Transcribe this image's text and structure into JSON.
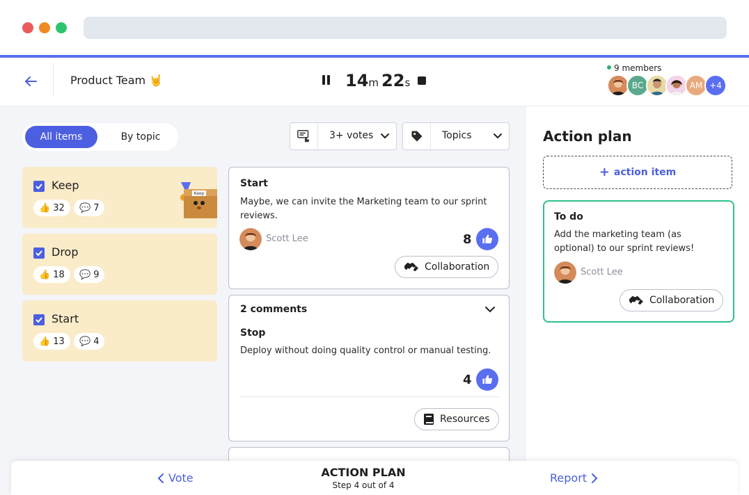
{
  "header": {
    "team_name": "Product Team",
    "team_emoji": "🤘",
    "timer": {
      "minutes": "14",
      "minutes_unit": "m",
      "seconds": "22",
      "seconds_unit": "s"
    },
    "members_label": "9 members",
    "avatars": [
      {
        "initials": "",
        "color": "#c96a3b"
      },
      {
        "initials": "BC",
        "color": "#5aa98c"
      },
      {
        "initials": "",
        "color": "#3d3d3d"
      },
      {
        "initials": "",
        "color": "#d18bc4"
      },
      {
        "initials": "AM",
        "color": "#e8a97c"
      },
      {
        "initials": "+4",
        "color": "#5a6ef0"
      }
    ]
  },
  "view_toggle": {
    "all_items": "All items",
    "by_topic": "By topic"
  },
  "filters": {
    "votes": "3+ votes",
    "topics": "Topics"
  },
  "categories": [
    {
      "name": "Keep",
      "likes": "32",
      "comments": "7"
    },
    {
      "name": "Drop",
      "likes": "18",
      "comments": "9"
    },
    {
      "name": "Start",
      "likes": "13",
      "comments": "4"
    }
  ],
  "sticker_label": "Keep",
  "cards": [
    {
      "title": "Start",
      "text": "Maybe, we can invite the Marketing team to our sprint reviews.",
      "author": "Scott Lee",
      "votes": "8",
      "tag": "Collaboration"
    },
    {
      "comments": "2 comments",
      "title": "Stop",
      "text": "Deploy without doing quality control or manual testing.",
      "votes": "4",
      "tag": "Resources"
    }
  ],
  "action_plan": {
    "title": "Action plan",
    "add_label": "action item",
    "todo": {
      "title": "To do",
      "text": "Add the marketing team (as optional) to our sprint reviews!",
      "author": "Scott Lee",
      "tag": "Collaboration"
    }
  },
  "footer": {
    "prev": "Vote",
    "next": "Report",
    "step_title": "ACTION PLAN",
    "step_sub": "Step 4 out of 4"
  },
  "colors": {
    "accent": "#5a6ef0",
    "category_bg": "#faebc9",
    "todo_border": "#2ec48a"
  }
}
